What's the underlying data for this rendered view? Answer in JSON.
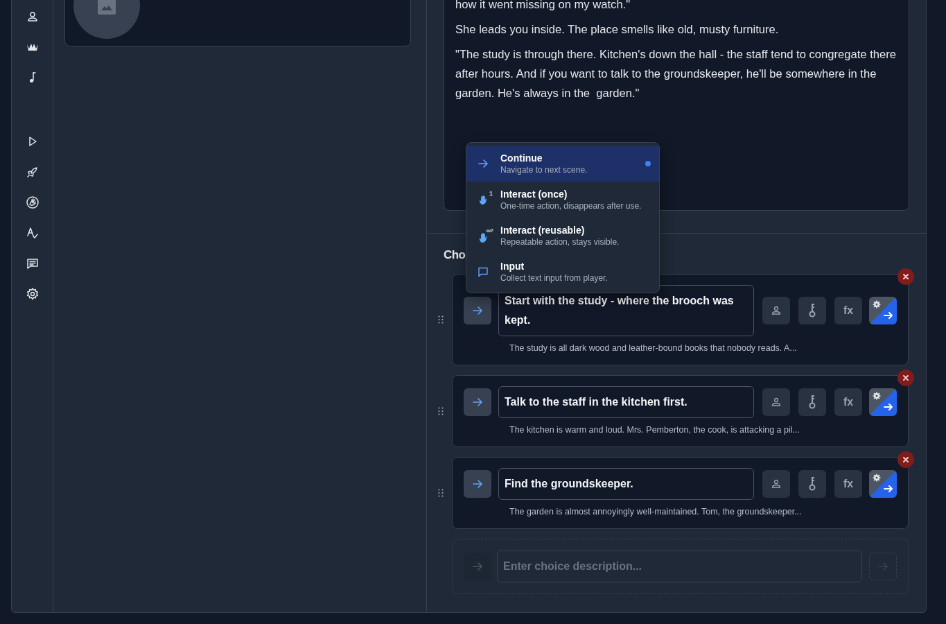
{
  "scene_text": {
    "paragraphs": [
      "how it went missing on my watch.\"",
      "She leads you inside. The place smells like old, musty furniture.",
      "\"The study is through there. Kitchen's down the hall - the staff tend to congregate there after hours. And if you want to talk to the groundskeeper, he'll be somewhere in the garden. He's always in the  garden.\""
    ]
  },
  "choices_heading": "Cho",
  "choice_type_menu": {
    "items": [
      {
        "kind": "continue",
        "title": "Continue",
        "description": "Navigate to next scene.",
        "selected": true
      },
      {
        "kind": "interact_once",
        "title": "Interact (once)",
        "description": "One-time action, disappears after use.",
        "badge": "1",
        "selected": false
      },
      {
        "kind": "interact_reusable",
        "title": "Interact (reusable)",
        "description": "Repeatable action, stays visible.",
        "selected": false
      },
      {
        "kind": "input",
        "title": "Input",
        "description": "Collect text input from player.",
        "selected": false
      }
    ]
  },
  "choices": [
    {
      "kind": "continue",
      "text": "Start with the study - where the brooch was kept.",
      "preview": "The study is all dark wood and leather-bound books that nobody reads. A...",
      "fx_label": "fx"
    },
    {
      "kind": "continue",
      "text": "Talk to the staff in the kitchen first.",
      "preview": "The kitchen is warm and loud. Mrs. Pemberton, the cook, is attacking a pil...",
      "fx_label": "fx"
    },
    {
      "kind": "continue",
      "text": "Find the groundskeeper.",
      "preview": "The garden is almost annoyingly well-maintained. Tom, the groundskeeper...",
      "fx_label": "fx"
    }
  ],
  "new_choice": {
    "placeholder": "Enter choice description..."
  }
}
